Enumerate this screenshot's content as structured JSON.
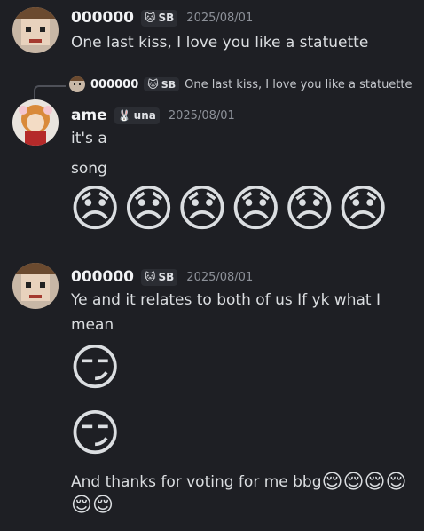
{
  "messages": [
    {
      "username": "000000",
      "tag": {
        "icon": "🐱",
        "label": "SB"
      },
      "timestamp": "2025/08/01",
      "lines": [
        "One last kiss, I love you like a statuette"
      ]
    },
    {
      "reply": {
        "username": "000000",
        "tag": {
          "icon": "🐱",
          "label": "SB"
        },
        "text": "One last kiss, I love you like a statuette"
      },
      "username": "ame",
      "tag": {
        "icon": "🐰",
        "label": "una"
      },
      "timestamp": "2025/08/01",
      "lines": [
        "it's a",
        "song"
      ],
      "emojis": [
        "😞",
        "😞",
        "😞",
        "😞",
        "😞",
        "😞"
      ]
    },
    {
      "username": "000000",
      "tag": {
        "icon": "🐱",
        "label": "SB"
      },
      "timestamp": "2025/08/01",
      "lines": [
        "Ye and it relates to both of us If yk what I",
        "mean"
      ],
      "emoji_lines": [
        "😏",
        "😏"
      ],
      "closing_text": "And thanks for voting for me bbg",
      "closing_emojis_inline": [
        "😌",
        "😌",
        "😌",
        "😌"
      ],
      "closing_emojis_wrap": [
        "😌",
        "😌"
      ]
    }
  ],
  "colors": {
    "background": "#1e1f24",
    "username": "#f2f3f5",
    "timestamp": "#8d9199",
    "text": "#dbdee1",
    "tag_bg": "#2b2d33"
  }
}
